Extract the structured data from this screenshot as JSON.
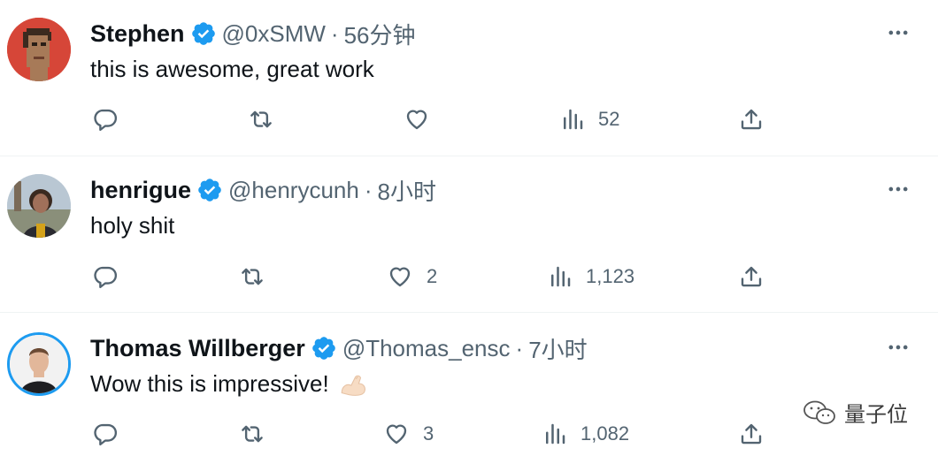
{
  "colors": {
    "accent": "#1d9bf0",
    "muted": "#536471",
    "text": "#0f1419"
  },
  "tweets": [
    {
      "name": "Stephen",
      "handle": "@0xSMW",
      "dot": "·",
      "time": "56分钟",
      "text": "this is awesome, great work",
      "emoji": "",
      "replies": "",
      "retweets": "",
      "likes": "",
      "views": "52",
      "avatar_icon": "pixel-punk-avatar"
    },
    {
      "name": "henrigue",
      "handle": "@henrycunh",
      "dot": "·",
      "time": "8小时",
      "text": "holy shit",
      "emoji": "",
      "replies": "",
      "retweets": "",
      "likes": "2",
      "views": "1,123",
      "avatar_icon": "photo-avatar"
    },
    {
      "name": "Thomas Willberger",
      "handle": "@Thomas_ensc",
      "dot": "·",
      "time": "7小时",
      "text": "Wow this is impressive!",
      "emoji": "flexed-biceps-emoji",
      "replies": "",
      "retweets": "",
      "likes": "3",
      "views": "1,082",
      "avatar_icon": "photo-avatar"
    }
  ],
  "watermark": {
    "text": "量子位",
    "icon": "wechat-icon"
  }
}
